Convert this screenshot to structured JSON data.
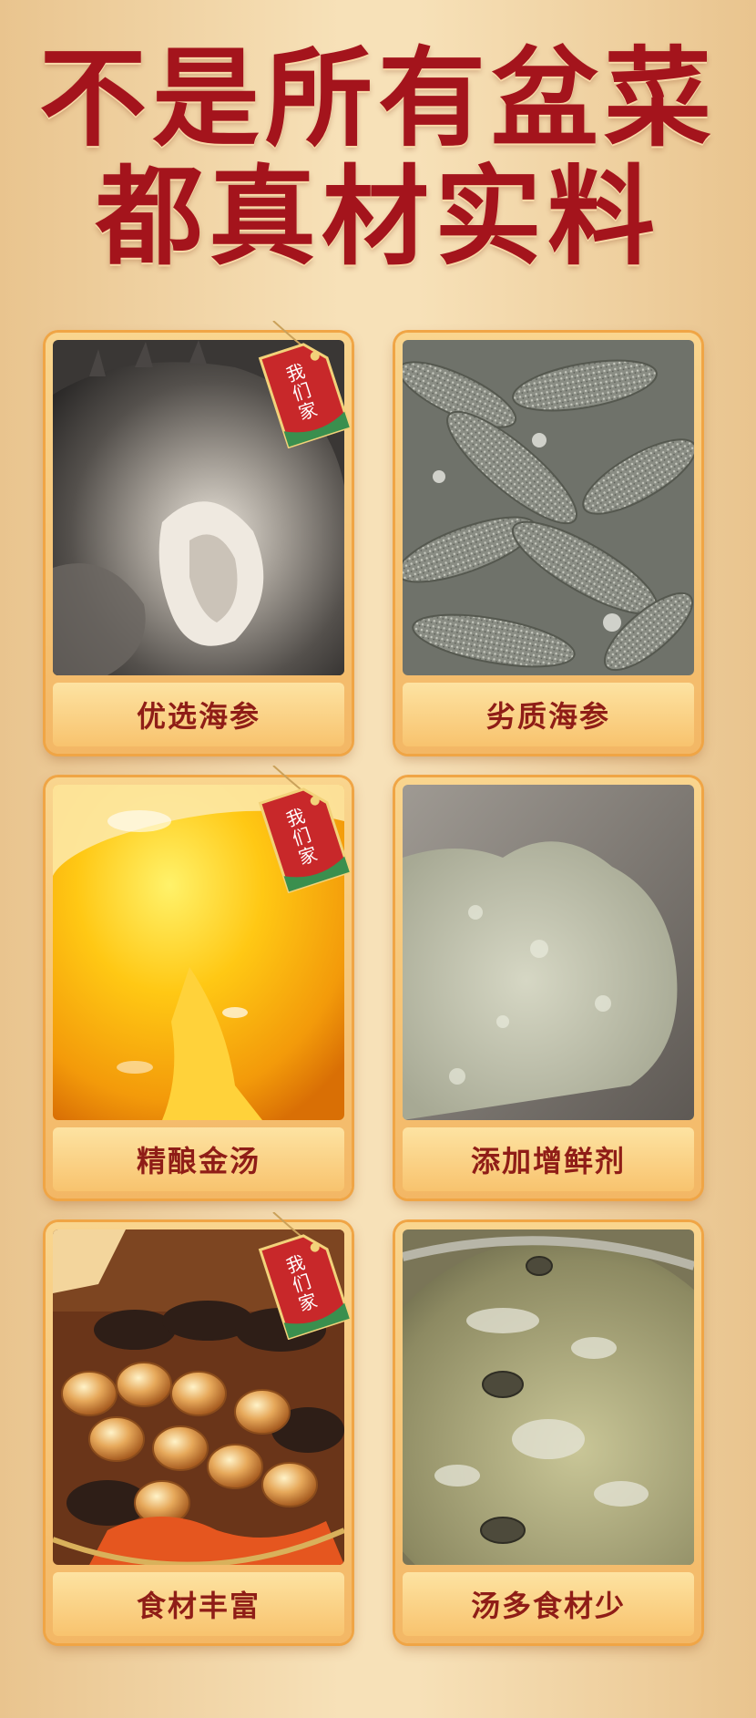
{
  "headline": {
    "line1": "不是所有盆菜",
    "line2": "都真材实料"
  },
  "tag_text": [
    "我",
    "们",
    "家"
  ],
  "cards": [
    {
      "caption": "优选海参"
    },
    {
      "caption": "劣质海参"
    },
    {
      "caption": "精酿金汤"
    },
    {
      "caption": "添加增鲜剂"
    },
    {
      "caption": "食材丰富"
    },
    {
      "caption": "汤多食材少"
    }
  ],
  "colors": {
    "headline": "#a4141c",
    "caption_text": "#8f1d17",
    "card_frame": "#f0a545",
    "tag_red": "#c8282a"
  }
}
